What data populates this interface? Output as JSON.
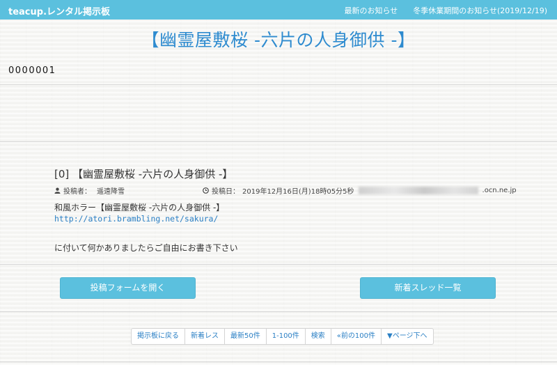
{
  "header": {
    "brand": "teacup.レンタル掲示板",
    "nav": [
      "最新のお知らせ",
      "冬季休業期間のお知らせ(2019/12/19)"
    ]
  },
  "board": {
    "title": "【幽霊屋敷桜 -六片の人身御供 -】",
    "counter": "0000001"
  },
  "post": {
    "title": "[0] 【幽霊屋敷桜 -六片の人身御供 -】",
    "author_label": "投稿者：",
    "author": "遥遠降雪",
    "date_label": "投稿日：",
    "date": "2019年12月16日(月)18時05分5秒",
    "host_suffix": ".ocn.ne.jp",
    "body_line1": "和風ホラー【幽霊屋敷桜 -六片の人身御供 -】",
    "body_link": "http://atori.brambling.net/sakura/",
    "body_line2": "に付いて何かありましたらご自由にお書き下さい"
  },
  "buttons": {
    "open_form": "投稿フォームを開く",
    "new_threads": "新着スレッド一覧"
  },
  "pager": [
    "掲示板に戻る",
    "新着レス",
    "最新50件",
    "1-100件",
    "検索",
    "«前の100件",
    "▼ページ下へ"
  ],
  "colors": {
    "accent": "#5bc0de",
    "title": "#2e8bcf",
    "link": "#2a7fc4"
  }
}
